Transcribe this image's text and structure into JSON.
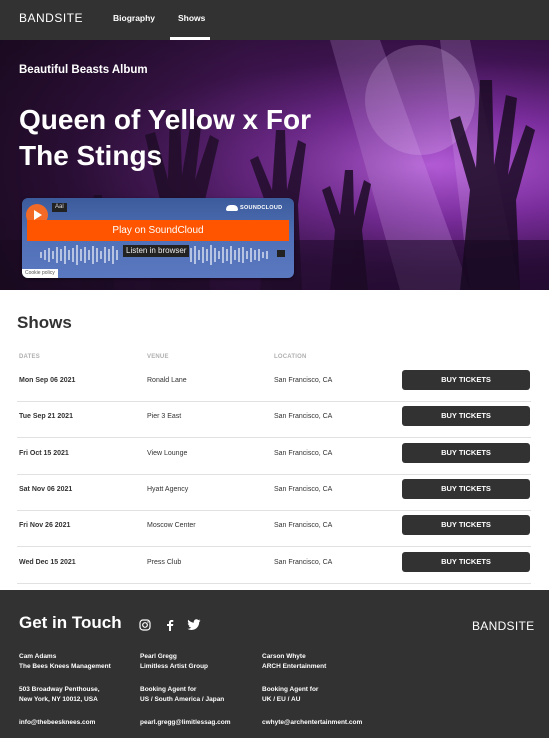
{
  "nav": {
    "logo": "BANDSITE",
    "links": [
      {
        "label": "Biography"
      },
      {
        "label": "Shows",
        "active": true
      }
    ]
  },
  "hero": {
    "album": "Beautiful Beasts Album",
    "title": "Queen of Yellow x For The Stings"
  },
  "player": {
    "track_label": "Aal",
    "brand": "SOUNDCLOUD",
    "play_button": "Play on SoundCloud",
    "browser_button": "Listen in browser",
    "cookie_policy": "Cookie policy",
    "accent_color": "#ff5500"
  },
  "shows": {
    "title": "Shows",
    "columns": {
      "date": "DATES",
      "venue": "VENUE",
      "location": "LOCATION"
    },
    "buy_label": "BUY TICKETS",
    "rows": [
      {
        "date": "Mon Sep 06 2021",
        "venue": "Ronald Lane",
        "location": "San Francisco, CA"
      },
      {
        "date": "Tue Sep 21 2021",
        "venue": "Pier 3 East",
        "location": "San Francisco, CA"
      },
      {
        "date": "Fri Oct 15 2021",
        "venue": "View Lounge",
        "location": "San Francisco, CA"
      },
      {
        "date": "Sat Nov 06 2021",
        "venue": "Hyatt Agency",
        "location": "San Francisco, CA"
      },
      {
        "date": "Fri Nov 26 2021",
        "venue": "Moscow Center",
        "location": "San Francisco, CA"
      },
      {
        "date": "Wed Dec 15 2021",
        "venue": "Press Club",
        "location": "San Francisco, CA"
      }
    ]
  },
  "footer": {
    "title": "Get in Touch",
    "brand": "BANDSITE",
    "social_icons": [
      "instagram-icon",
      "facebook-icon",
      "twitter-icon"
    ],
    "contacts": [
      {
        "name": "Cam Adams",
        "org": "The Bees Knees Management",
        "line1": "503 Broadway Penthouse,",
        "line2": "New York, NY 10012, USA",
        "email": "info@thebeesknees.com"
      },
      {
        "name": "Pearl Gregg",
        "org": "Limitless Artist Group",
        "line1": "Booking Agent for",
        "line2": "US / South America / Japan",
        "email": "pearl.gregg@limitlessag.com"
      },
      {
        "name": "Carson Whyte",
        "org": "ARCH Entertainment",
        "line1": "Booking Agent for",
        "line2": "UK / EU / AU",
        "email": "cwhyte@archentertainment.com"
      }
    ]
  }
}
